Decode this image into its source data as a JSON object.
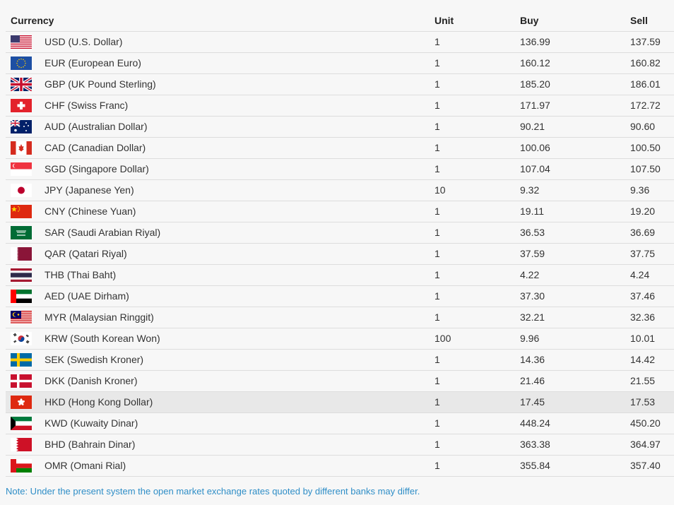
{
  "table": {
    "headers": {
      "currency": "Currency",
      "unit": "Unit",
      "buy": "Buy",
      "sell": "Sell"
    },
    "rows": [
      {
        "flag": "us-flag-icon",
        "currency": "USD (U.S. Dollar)",
        "unit": "1",
        "buy": "136.99",
        "sell": "137.59"
      },
      {
        "flag": "eu-flag-icon",
        "currency": "EUR (European Euro)",
        "unit": "1",
        "buy": "160.12",
        "sell": "160.82"
      },
      {
        "flag": "uk-flag-icon",
        "currency": "GBP (UK Pound Sterling)",
        "unit": "1",
        "buy": "185.20",
        "sell": "186.01"
      },
      {
        "flag": "ch-flag-icon",
        "currency": "CHF (Swiss Franc)",
        "unit": "1",
        "buy": "171.97",
        "sell": "172.72"
      },
      {
        "flag": "au-flag-icon",
        "currency": "AUD (Australian Dollar)",
        "unit": "1",
        "buy": "90.21",
        "sell": "90.60"
      },
      {
        "flag": "ca-flag-icon",
        "currency": "CAD (Canadian Dollar)",
        "unit": "1",
        "buy": "100.06",
        "sell": "100.50"
      },
      {
        "flag": "sg-flag-icon",
        "currency": "SGD (Singapore Dollar)",
        "unit": "1",
        "buy": "107.04",
        "sell": "107.50"
      },
      {
        "flag": "jp-flag-icon",
        "currency": "JPY (Japanese Yen)",
        "unit": "10",
        "buy": "9.32",
        "sell": "9.36"
      },
      {
        "flag": "cn-flag-icon",
        "currency": "CNY (Chinese Yuan)",
        "unit": "1",
        "buy": "19.11",
        "sell": "19.20"
      },
      {
        "flag": "sa-flag-icon",
        "currency": "SAR (Saudi Arabian Riyal)",
        "unit": "1",
        "buy": "36.53",
        "sell": "36.69"
      },
      {
        "flag": "qa-flag-icon",
        "currency": "QAR (Qatari Riyal)",
        "unit": "1",
        "buy": "37.59",
        "sell": "37.75"
      },
      {
        "flag": "th-flag-icon",
        "currency": "THB (Thai Baht)",
        "unit": "1",
        "buy": "4.22",
        "sell": "4.24"
      },
      {
        "flag": "ae-flag-icon",
        "currency": "AED (UAE Dirham)",
        "unit": "1",
        "buy": "37.30",
        "sell": "37.46"
      },
      {
        "flag": "my-flag-icon",
        "currency": "MYR (Malaysian Ringgit)",
        "unit": "1",
        "buy": "32.21",
        "sell": "32.36"
      },
      {
        "flag": "kr-flag-icon",
        "currency": "KRW (South Korean Won)",
        "unit": "100",
        "buy": "9.96",
        "sell": "10.01"
      },
      {
        "flag": "se-flag-icon",
        "currency": "SEK (Swedish Kroner)",
        "unit": "1",
        "buy": "14.36",
        "sell": "14.42"
      },
      {
        "flag": "dk-flag-icon",
        "currency": "DKK (Danish Kroner)",
        "unit": "1",
        "buy": "21.46",
        "sell": "21.55"
      },
      {
        "flag": "hk-flag-icon",
        "currency": "HKD (Hong Kong Dollar)",
        "unit": "1",
        "buy": "17.45",
        "sell": "17.53"
      },
      {
        "flag": "kw-flag-icon",
        "currency": "KWD (Kuwaity Dinar)",
        "unit": "1",
        "buy": "448.24",
        "sell": "450.20"
      },
      {
        "flag": "bh-flag-icon",
        "currency": "BHD (Bahrain Dinar)",
        "unit": "1",
        "buy": "363.38",
        "sell": "364.97"
      },
      {
        "flag": "om-flag-icon",
        "currency": "OMR (Omani Rial)",
        "unit": "1",
        "buy": "355.84",
        "sell": "357.40"
      }
    ]
  },
  "note": "Note: Under the present system the open market exchange rates quoted by different banks may differ.",
  "colors": {
    "note_text": "#2f8ec7",
    "row_border": "#dddddd",
    "hover_row": "#e8e8e8"
  }
}
